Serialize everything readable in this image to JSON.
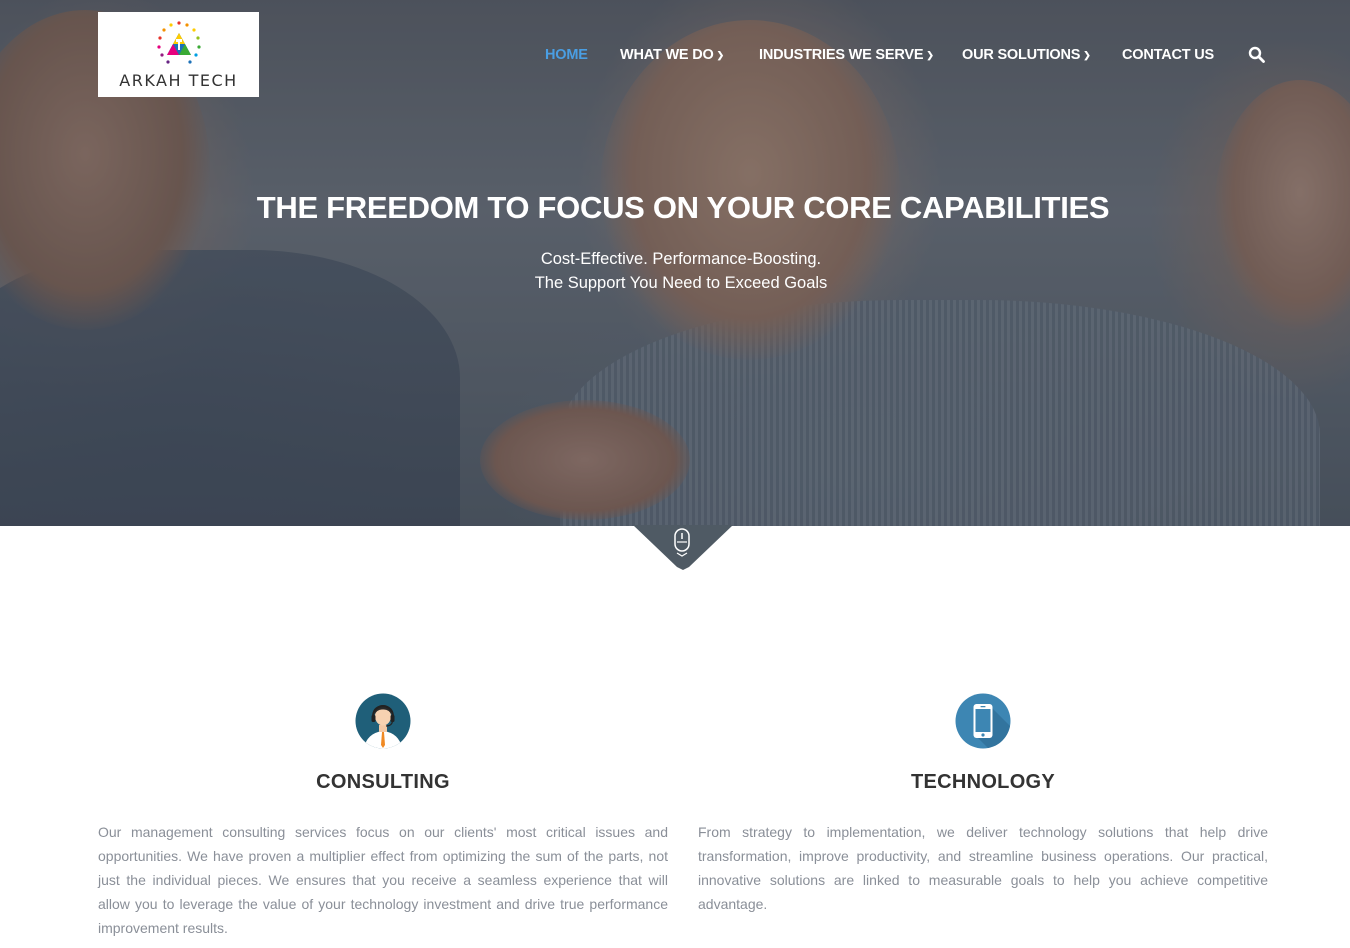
{
  "brand": {
    "logo_text": "ARKAH TECH"
  },
  "nav": {
    "items": [
      {
        "label": "HOME",
        "active": true
      },
      {
        "label": "WHAT WE DO",
        "dropdown": true
      },
      {
        "label": "INDUSTRIES WE SERVE",
        "dropdown": true
      },
      {
        "label": "OUR SOLUTIONS",
        "dropdown": true
      },
      {
        "label": "CONTACT US"
      }
    ],
    "search_icon": "search-icon",
    "active_color": "#4a9ee3"
  },
  "hero": {
    "title": "THE FREEDOM TO FOCUS ON YOUR CORE CAPABILITIES",
    "subtitle_line1": "Cost-Effective. Performance-Boosting.",
    "subtitle_line2": "The Support You Need to Exceed Goals",
    "scroll_icon": "mouse-icon"
  },
  "services": [
    {
      "icon": "consultant-avatar-icon",
      "title": "CONSULTING",
      "text": "Our management consulting services focus on our clients' most critical issues and opportunities. We have proven a multiplier effect from optimizing the sum of the parts, not just the individual pieces. We ensures that you receive a seamless experience that will allow you to leverage the value of your technology investment and drive true performance improvement results."
    },
    {
      "icon": "smartphone-icon",
      "title": "TECHNOLOGY",
      "text": "From strategy to implementation, we deliver technology solutions that help drive transformation, improve productivity, and streamline business operations. Our practical, innovative solutions are linked to measurable goals to help you achieve competitive advantage."
    }
  ]
}
